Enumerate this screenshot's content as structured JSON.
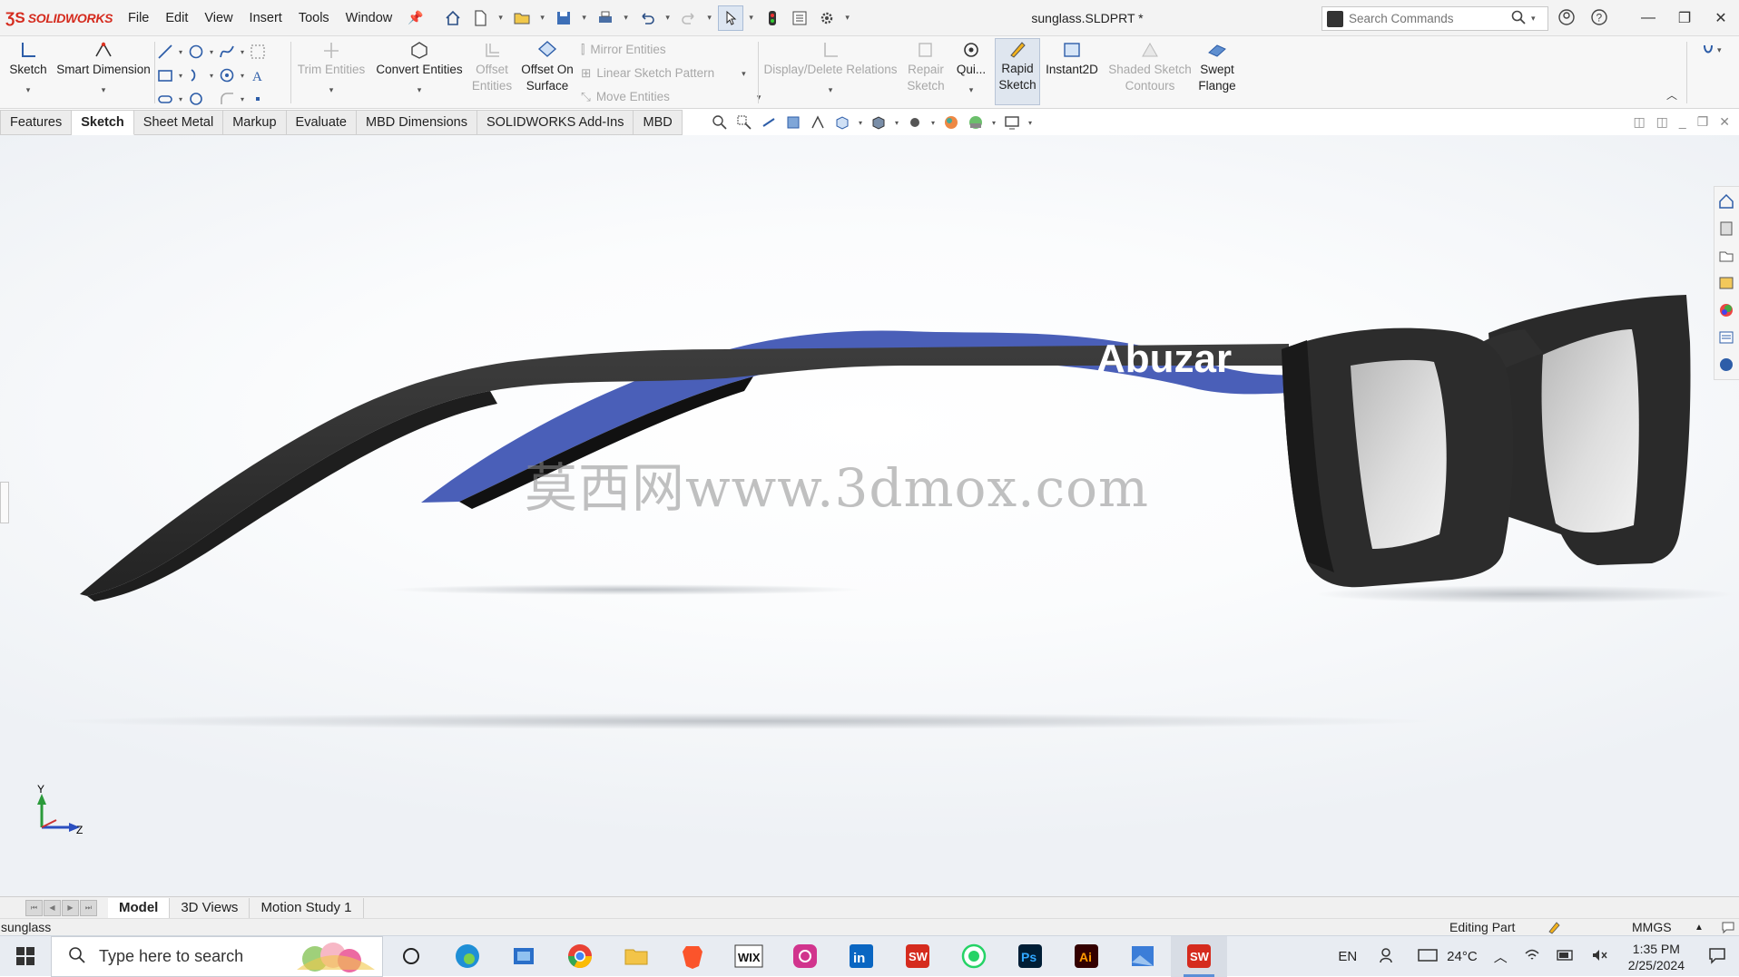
{
  "app": {
    "brand": "SOLIDWORKS",
    "document_title": "sunglass.SLDPRT *"
  },
  "menu": [
    "File",
    "Edit",
    "View",
    "Insert",
    "Tools",
    "Window"
  ],
  "search": {
    "placeholder": "Search Commands"
  },
  "ribbon": {
    "sketch": "Sketch",
    "smart_dimension": "Smart Dimension",
    "trim_entities": "Trim Entities",
    "convert_entities": "Convert Entities",
    "offset_entities": "Offset Entities",
    "offset_on_surface": "Offset On Surface",
    "mirror_entities": "Mirror Entities",
    "linear_sketch_pattern": "Linear Sketch Pattern",
    "move_entities": "Move Entities",
    "display_delete_relations": "Display/Delete Relations",
    "repair_sketch": "Repair Sketch",
    "quick_snaps": "Qui...",
    "rapid_sketch": "Rapid Sketch",
    "instant2d": "Instant2D",
    "shaded_sketch_contours": "Shaded Sketch Contours",
    "swept_flange": "Swept Flange"
  },
  "tabs": [
    "Features",
    "Sketch",
    "Sheet Metal",
    "Markup",
    "Evaluate",
    "MBD Dimensions",
    "SOLIDWORKS Add-Ins",
    "MBD"
  ],
  "active_tab": "Sketch",
  "viewport": {
    "engraving": "Abuzar",
    "watermark": "莫西网www.3dmox.com",
    "axis_y": "Y",
    "axis_z": "Z",
    "colors": {
      "frame": "#3a3a3a",
      "temple_inner": "#4a5fb8",
      "lens": "#c9c9c9"
    }
  },
  "bottom_tabs": [
    "Model",
    "3D Views",
    "Motion Study 1"
  ],
  "status": {
    "part": "sunglass",
    "mode": "Editing Part",
    "units": "MMGS"
  },
  "taskbar": {
    "search_placeholder": "Type here to search",
    "language": "EN",
    "temperature": "24°C",
    "time": "1:35 PM",
    "date": "2/25/2024",
    "apps": [
      "edge",
      "file-transfer",
      "chrome",
      "file-explorer",
      "brave",
      "wix",
      "instagram",
      "linkedin",
      "solidworks-2021",
      "whatsapp",
      "photoshop",
      "illustrator",
      "photos",
      "solidworks-2021-active"
    ]
  }
}
